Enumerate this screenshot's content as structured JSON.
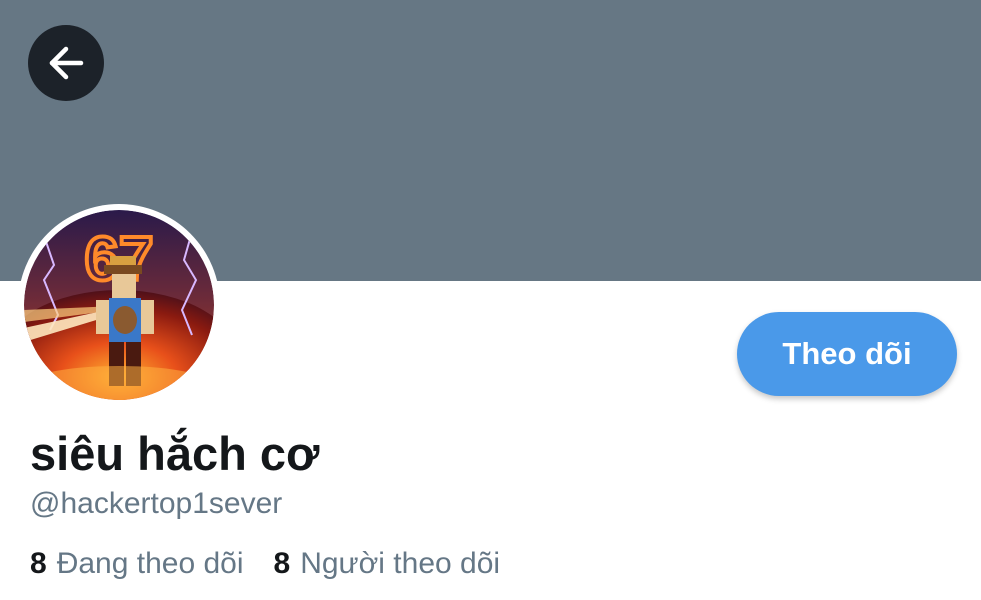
{
  "header": {
    "back_icon": "arrow-left-icon",
    "banner_color": "#667784"
  },
  "profile": {
    "avatar_icon": "avatar-image",
    "display_name": "siêu hắch cơ",
    "username": "@hackertop1sever",
    "follow_label": "Theo dõi",
    "accent_color": "#4a99e9"
  },
  "stats": {
    "following_count": "8",
    "following_label": "Đang theo dõi",
    "followers_count": "8",
    "followers_label": "Người theo dõi"
  },
  "avatar_text": "67"
}
